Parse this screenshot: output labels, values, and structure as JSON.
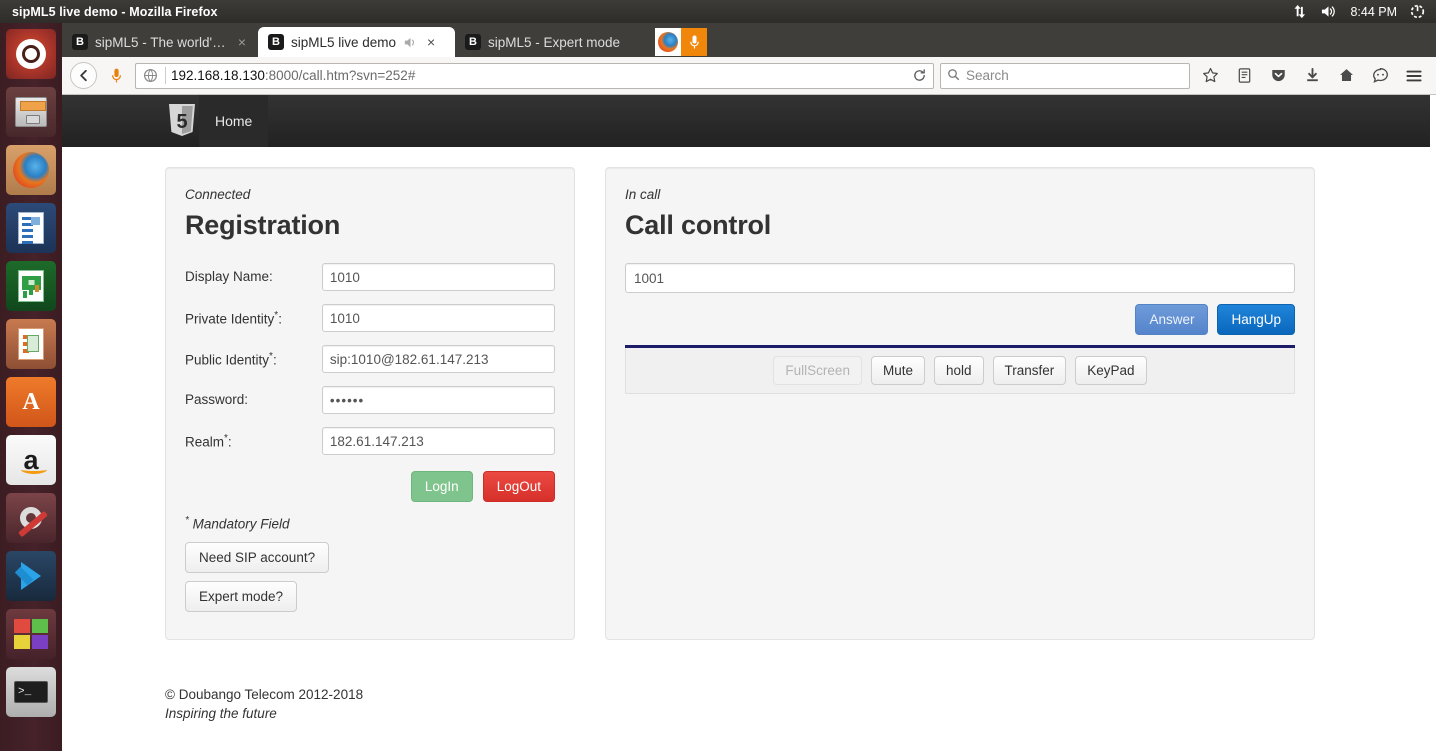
{
  "desktop": {
    "window_title": "sipML5 live demo - Mozilla Firefox",
    "clock": "8:44 PM",
    "tray": [
      {
        "name": "network-icon",
        "label": "network"
      },
      {
        "name": "volume-icon",
        "label": "volume"
      },
      {
        "name": "system-menu-icon",
        "label": "system"
      }
    ],
    "launcher": [
      {
        "name": "launcher-item-ubuntu-dash",
        "label": "Ubuntu Dash",
        "running": false
      },
      {
        "name": "launcher-item-files",
        "label": "Files",
        "running": true
      },
      {
        "name": "launcher-item-firefox",
        "label": "Firefox",
        "running": true
      },
      {
        "name": "launcher-item-libreoffice-writer",
        "label": "LibreOffice Writer",
        "running": false
      },
      {
        "name": "launcher-item-libreoffice-calc",
        "label": "LibreOffice Calc",
        "running": false
      },
      {
        "name": "launcher-item-libreoffice-impress",
        "label": "LibreOffice Impress",
        "running": false
      },
      {
        "name": "launcher-item-ubuntu-software",
        "label": "Ubuntu Software",
        "running": false
      },
      {
        "name": "launcher-item-amazon",
        "label": "Amazon",
        "running": false
      },
      {
        "name": "launcher-item-system-settings",
        "label": "System Settings",
        "running": false
      },
      {
        "name": "launcher-item-vscode",
        "label": "Visual Studio Code",
        "running": false
      },
      {
        "name": "launcher-item-workspace-switcher",
        "label": "Workspace Switcher",
        "running": false
      },
      {
        "name": "launcher-item-terminal",
        "label": "Terminal",
        "running": true
      }
    ]
  },
  "browser": {
    "tabs": [
      {
        "favicon_letter": "B",
        "title": "sipML5 - The world's...",
        "active": false,
        "audio": false,
        "close": "×"
      },
      {
        "favicon_letter": "B",
        "title": "sipML5 live demo",
        "active": true,
        "audio": true,
        "close": "×"
      },
      {
        "favicon_letter": "B",
        "title": "sipML5 - Expert mode",
        "active": false,
        "audio": false,
        "close": ""
      }
    ],
    "url_host": "192.168.18.130",
    "url_rest": ":8000/call.htm?svn=252#",
    "search_placeholder": "Search",
    "toolbar_icons": [
      {
        "name": "back-button",
        "label": "Back"
      },
      {
        "name": "microphone-permission-icon",
        "label": "Microphone in use"
      },
      {
        "name": "page-identity-icon",
        "label": "Site information"
      },
      {
        "name": "reload-button",
        "label": "Reload"
      },
      {
        "name": "bookmark-star-icon",
        "label": "Bookmark this page"
      },
      {
        "name": "reader-view-icon",
        "label": "Reader view"
      },
      {
        "name": "pocket-icon",
        "label": "Save to Pocket"
      },
      {
        "name": "downloads-icon",
        "label": "Downloads"
      },
      {
        "name": "home-icon",
        "label": "Home"
      },
      {
        "name": "sync-icon",
        "label": "Sync"
      },
      {
        "name": "menu-hamburger-icon",
        "label": "Open menu"
      }
    ]
  },
  "site": {
    "brand": "html5-logo",
    "nav": [
      {
        "label": "Home",
        "active": true
      }
    ]
  },
  "registration": {
    "status": "Connected",
    "title": "Registration",
    "fields": [
      {
        "label": "Display Name:",
        "required": false,
        "value": "1010",
        "name": "display-name-input"
      },
      {
        "label": "Private Identity",
        "required": true,
        "value": "1010",
        "name": "private-identity-input"
      },
      {
        "label": "Public Identity",
        "required": true,
        "value": "sip:1010@182.61.147.213",
        "name": "public-identity-input"
      },
      {
        "label": "Password:",
        "required": false,
        "value": "••••••",
        "name": "password-input"
      },
      {
        "label": "Realm",
        "required": true,
        "value": "182.61.147.213",
        "name": "realm-input"
      }
    ],
    "login_label": "LogIn",
    "logout_label": "LogOut",
    "mandatory_note": "Mandatory Field",
    "need_account_label": "Need SIP account?",
    "expert_mode_label": "Expert mode?"
  },
  "call_control": {
    "status": "In call",
    "title": "Call control",
    "uri_value": "1001",
    "uri_placeholder": "",
    "answer_label": "Answer",
    "hangup_label": "HangUp",
    "media_buttons": [
      {
        "label": "FullScreen",
        "name": "fullscreen-button",
        "disabled": true
      },
      {
        "label": "Mute",
        "name": "mute-button",
        "disabled": false
      },
      {
        "label": "hold",
        "name": "hold-button",
        "disabled": false
      },
      {
        "label": "Transfer",
        "name": "transfer-button",
        "disabled": false
      },
      {
        "label": "KeyPad",
        "name": "keypad-button",
        "disabled": false
      }
    ]
  },
  "footer": {
    "copyright": "© Doubango Telecom 2012-2018",
    "tagline": "Inspiring the future"
  },
  "colors": {
    "navbar_bg": "#2d2d2d",
    "panel_bg": "#f5f5f5",
    "login_green": "#7fc48c",
    "logout_red": "#e23c34",
    "hangup_blue": "#0e71c8",
    "answer_blue": "#5d8fd4",
    "divider_navy": "#1c1c68"
  }
}
